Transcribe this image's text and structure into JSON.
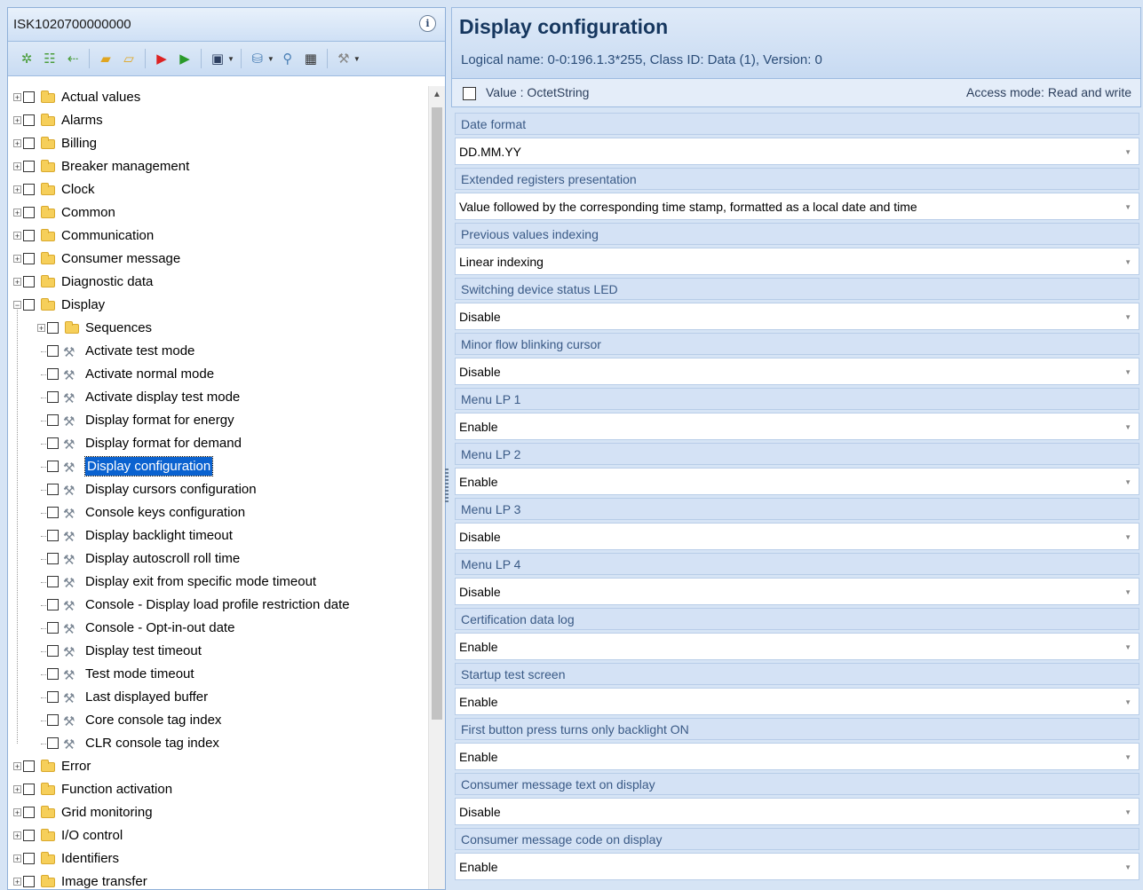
{
  "left_panel": {
    "device_id": "ISK1020700000000",
    "info_icon": "i"
  },
  "right_panel": {
    "title": "Display configuration",
    "logical_name": "Logical name: 0-0:196.1.3*255, Class ID: Data (1), Version: 0",
    "value_type": "Value : OctetString",
    "access_mode": "Access mode: Read and write"
  },
  "tree": [
    {
      "label": "Actual values",
      "type": "folder",
      "level": 0,
      "expanded": false
    },
    {
      "label": "Alarms",
      "type": "folder",
      "level": 0,
      "expanded": false
    },
    {
      "label": "Billing",
      "type": "folder",
      "level": 0,
      "expanded": false
    },
    {
      "label": "Breaker management",
      "type": "folder",
      "level": 0,
      "expanded": false
    },
    {
      "label": "Clock",
      "type": "folder",
      "level": 0,
      "expanded": false
    },
    {
      "label": "Common",
      "type": "folder",
      "level": 0,
      "expanded": false
    },
    {
      "label": "Communication",
      "type": "folder",
      "level": 0,
      "expanded": false
    },
    {
      "label": "Consumer message",
      "type": "folder",
      "level": 0,
      "expanded": false
    },
    {
      "label": "Diagnostic data",
      "type": "folder",
      "level": 0,
      "expanded": false
    },
    {
      "label": "Display",
      "type": "folder",
      "level": 0,
      "expanded": true
    },
    {
      "label": "Sequences",
      "type": "folder",
      "level": 1,
      "expanded": false
    },
    {
      "label": "Activate test mode",
      "type": "item",
      "level": 1
    },
    {
      "label": "Activate normal mode",
      "type": "item",
      "level": 1
    },
    {
      "label": "Activate display test mode",
      "type": "item",
      "level": 1
    },
    {
      "label": "Display format for energy",
      "type": "item",
      "level": 1
    },
    {
      "label": "Display format for demand",
      "type": "item",
      "level": 1
    },
    {
      "label": "Display configuration",
      "type": "item",
      "level": 1,
      "selected": true
    },
    {
      "label": "Display cursors configuration",
      "type": "item",
      "level": 1
    },
    {
      "label": "Console keys configuration",
      "type": "item",
      "level": 1
    },
    {
      "label": "Display backlight timeout",
      "type": "item",
      "level": 1
    },
    {
      "label": "Display autoscroll roll time",
      "type": "item",
      "level": 1
    },
    {
      "label": "Display exit from specific mode timeout",
      "type": "item",
      "level": 1
    },
    {
      "label": "Console - Display load profile restriction date",
      "type": "item",
      "level": 1
    },
    {
      "label": "Console - Opt-in-out date",
      "type": "item",
      "level": 1
    },
    {
      "label": "Display test timeout",
      "type": "item",
      "level": 1
    },
    {
      "label": "Test mode timeout",
      "type": "item",
      "level": 1
    },
    {
      "label": "Last displayed buffer",
      "type": "item",
      "level": 1
    },
    {
      "label": "Core console tag index",
      "type": "item",
      "level": 1
    },
    {
      "label": "CLR console tag index",
      "type": "item",
      "level": 1
    },
    {
      "label": "Error",
      "type": "folder",
      "level": 0,
      "expanded": false
    },
    {
      "label": "Function activation",
      "type": "folder",
      "level": 0,
      "expanded": false
    },
    {
      "label": "Grid monitoring",
      "type": "folder",
      "level": 0,
      "expanded": false
    },
    {
      "label": "I/O control",
      "type": "folder",
      "level": 0,
      "expanded": false
    },
    {
      "label": "Identifiers",
      "type": "folder",
      "level": 0,
      "expanded": false
    },
    {
      "label": "Image transfer",
      "type": "folder",
      "level": 0,
      "expanded": false
    }
  ],
  "fields": [
    {
      "label": "Date format",
      "value": "DD.MM.YY"
    },
    {
      "label": "Extended registers presentation",
      "value": "Value followed by the corresponding time stamp, formatted as a local date and time"
    },
    {
      "label": "Previous values indexing",
      "value": "Linear indexing"
    },
    {
      "label": "Switching device status LED",
      "value": "Disable"
    },
    {
      "label": "Minor flow blinking cursor",
      "value": "Disable"
    },
    {
      "label": "Menu LP 1",
      "value": "Enable"
    },
    {
      "label": "Menu LP 2",
      "value": "Enable"
    },
    {
      "label": "Menu LP 3",
      "value": "Disable"
    },
    {
      "label": "Menu LP 4",
      "value": "Disable"
    },
    {
      "label": "Certification data log",
      "value": "Enable"
    },
    {
      "label": "Startup test screen",
      "value": "Enable"
    },
    {
      "label": "First button press turns only backlight ON",
      "value": "Enable"
    },
    {
      "label": "Consumer message text on display",
      "value": "Disable"
    },
    {
      "label": "Consumer message code on display",
      "value": "Enable"
    }
  ],
  "colors": {
    "selection": "#0a62d0",
    "title": "#16375f",
    "field_label_bg": "#d4e2f5"
  }
}
